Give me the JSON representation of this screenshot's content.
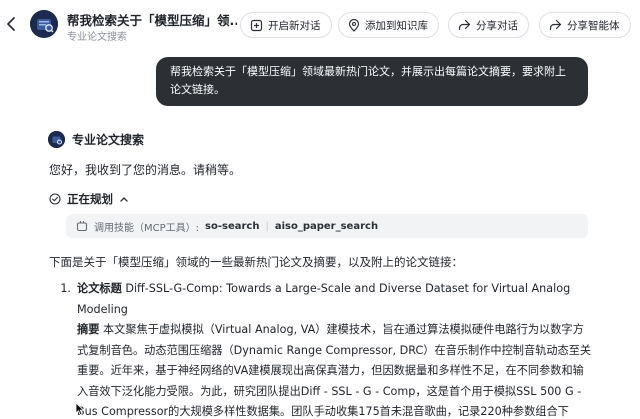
{
  "header": {
    "title": "帮我检索关于「模型压缩」领...",
    "subtitle": "专业论文搜索",
    "buttons": {
      "new_chat": "开启新对话",
      "add_kb": "添加到知识库",
      "share_chat": "分享对话",
      "share_agent": "分享智能体"
    }
  },
  "user_message": "帮我检索关于「模型压缩」领域最新热门论文，并展示出每篇论文摘要，要求附上论文链接。",
  "agent": {
    "name": "专业论文搜索",
    "greeting": "您好，我收到了您的消息。请稍等。",
    "plan_label": "正在规划",
    "tool_call": {
      "label": "调用技能（MCP工具）:",
      "tools": [
        "so-search",
        "aiso_paper_search"
      ]
    },
    "intro": "下面是关于「模型压缩」领域的一些最新热门论文及摘要，以及附上的论文链接：",
    "papers": [
      {
        "num": "1.",
        "title_label": "论文标题",
        "title": "Diff-SSL-G-Comp: Towards a Large-Scale and Diverse Dataset for Virtual Analog Modeling",
        "abstract_label": "摘要",
        "abstract": "本文聚焦于虚拟模拟（Virtual Analog, VA）建模技术，旨在通过算法模拟硬件电路行为以数字方式复制音色。动态范围压缩器（Dynamic Range Compressor, DRC）在音乐制作中控制音轨动态至关重要。近年来，基于神经网络的VA建模展现出高保真潜力，但因数据量和多样性不足，在不同参数和输入音效下泛化能力受限。为此，研究团队提出Diff - SSL - G - Comp，这是首个用于模拟SSL 500 G - Bus Compressor的大规模多样性数据集。团队手动收集175首未混音歌曲，记录220种参数组合下"
      }
    ]
  }
}
